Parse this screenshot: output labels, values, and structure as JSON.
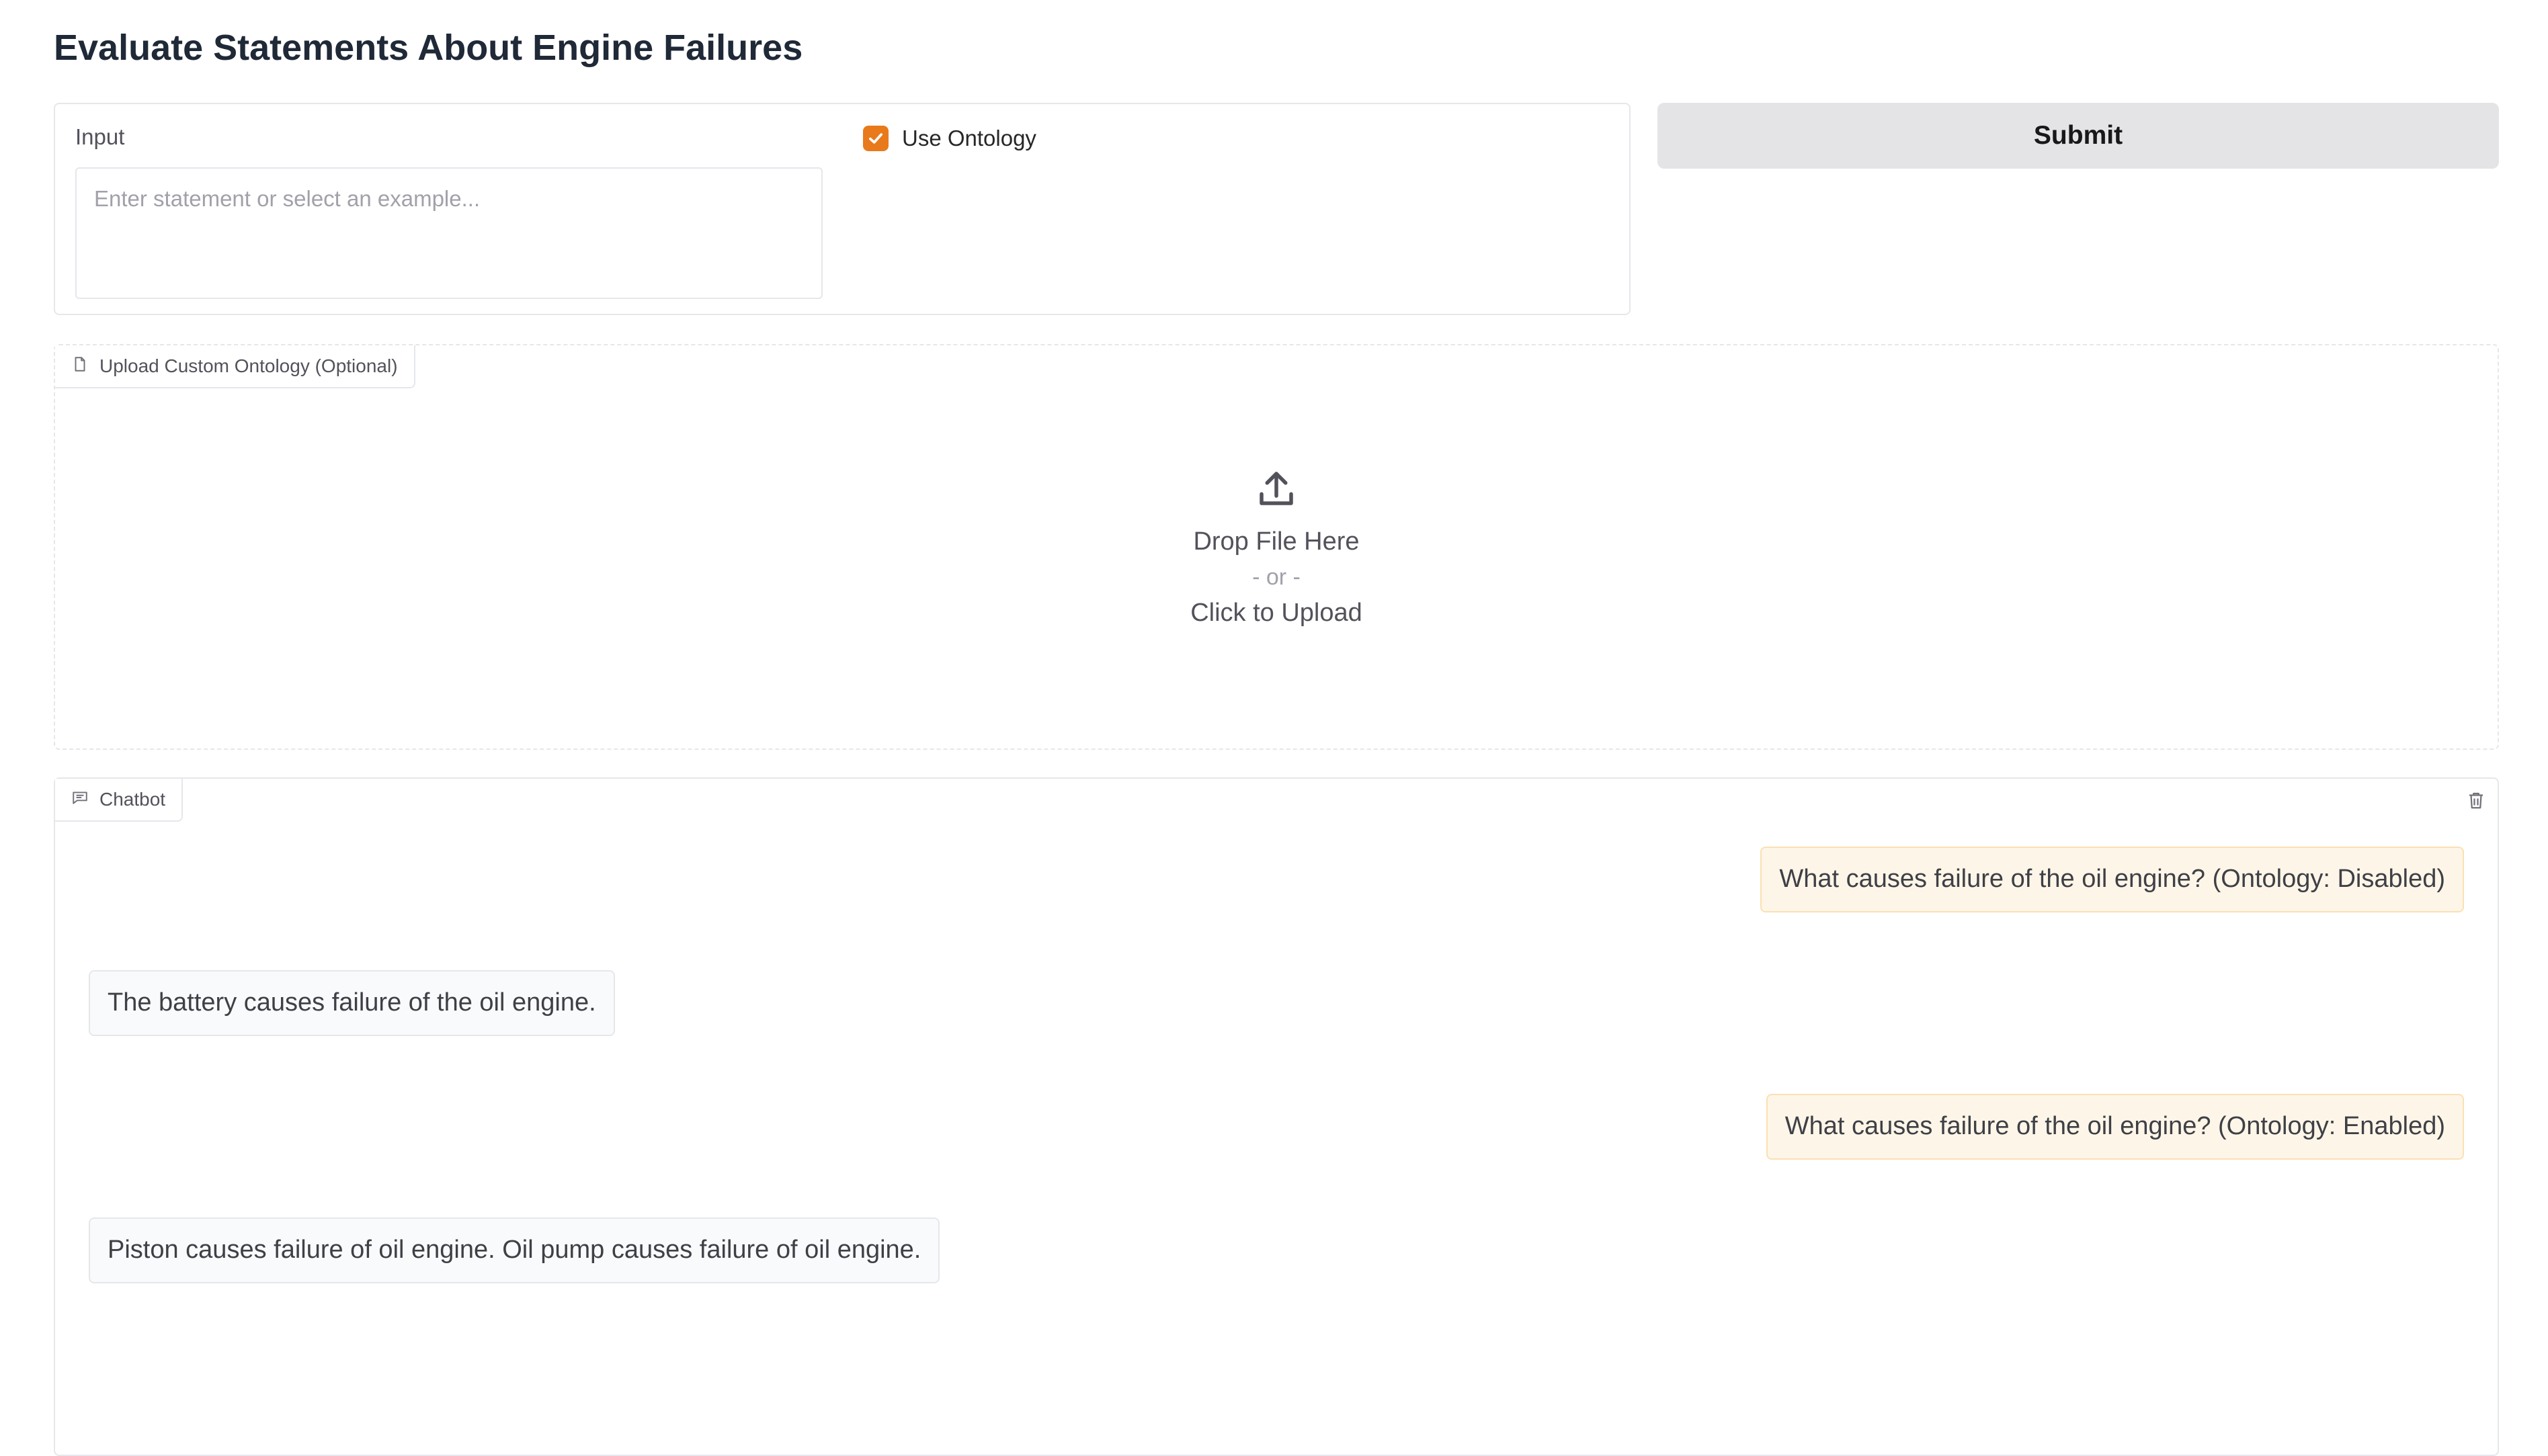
{
  "title": "Evaluate Statements About Engine Failures",
  "input": {
    "label": "Input",
    "placeholder": "Enter statement or select an example...",
    "value": ""
  },
  "ontology_toggle": {
    "label": "Use Ontology",
    "checked": true
  },
  "submit_label": "Submit",
  "upload": {
    "tag": "Upload Custom Ontology (Optional)",
    "drop_text": "Drop File Here",
    "or_text": "- or -",
    "click_text": "Click to Upload"
  },
  "chatbot": {
    "tag": "Chatbot",
    "messages": [
      {
        "role": "user",
        "text": "What causes failure of the oil engine? (Ontology: Disabled)"
      },
      {
        "role": "bot",
        "text": "The battery causes failure of the oil engine."
      },
      {
        "role": "user",
        "text": "What causes failure of the oil engine? (Ontology: Enabled)"
      },
      {
        "role": "bot",
        "text": "Piston causes failure of oil engine. Oil pump causes failure of oil engine."
      }
    ]
  },
  "colors": {
    "accent": "#e87a1b",
    "user_bubble": "#fdf6e8",
    "bot_bubble": "#f9fafb"
  }
}
